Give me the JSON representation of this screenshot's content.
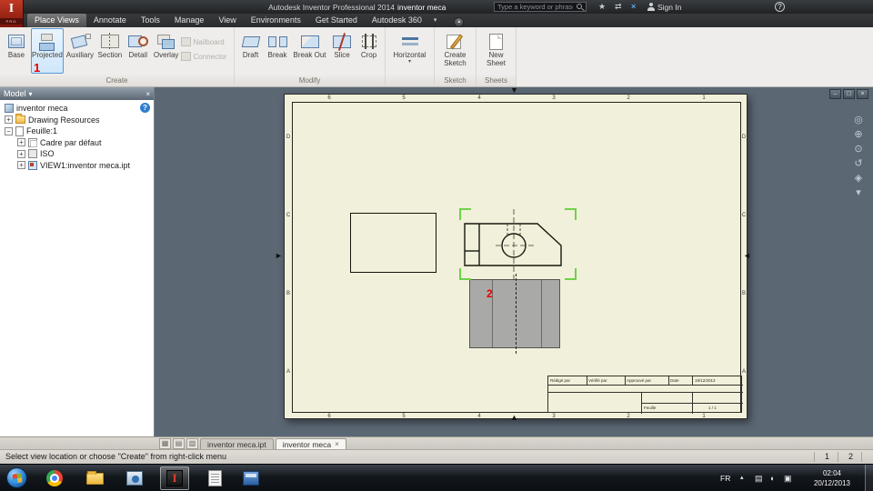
{
  "icons": {
    "close": "×",
    "dropdown": "▾",
    "minimize": "–",
    "restore": "□",
    "up": "▴",
    "plus": "+",
    "minus": "−",
    "help": "?",
    "star": "★",
    "link": "⇄",
    "x_blue": "×",
    "arrow_down": "▼",
    "arrow_up": "▲",
    "arrow_right": "►",
    "arrow_left": "◄",
    "nav": [
      "◎",
      "⊕",
      "⊙",
      "↺",
      "◈",
      "▾"
    ],
    "tray": [
      "▤",
      "◖",
      "▣"
    ],
    "view_buttons": [
      "▦",
      "▤",
      "▧"
    ]
  },
  "title_bar": {
    "logo": "I",
    "logo_sub": "PRO",
    "app_name": "Autodesk Inventor Professional 2014",
    "doc_name": "inventor meca",
    "search_placeholder": "Type a keyword or phrase",
    "sign_in": "Sign In"
  },
  "ribbon_tabs": [
    {
      "label": "Place Views"
    },
    {
      "label": "Annotate"
    },
    {
      "label": "Tools"
    },
    {
      "label": "Manage"
    },
    {
      "label": "View"
    },
    {
      "label": "Environments"
    },
    {
      "label": "Get Started"
    },
    {
      "label": "Autodesk 360"
    }
  ],
  "ribbon": {
    "create_label": "Create",
    "base": "Base",
    "projected": "Projected",
    "auxiliary": "Auxiliary",
    "section": "Section",
    "detail": "Detail",
    "overlay": "Overlay",
    "nailboard": "Nailboard",
    "connector": "Connector",
    "modify_label": "Modify",
    "draft": "Draft",
    "break": "Break",
    "break_out": "Break Out",
    "slice": "Slice",
    "crop": "Crop",
    "horizontal": "Horizontal",
    "sketch_label": "Sketch",
    "create_sketch": "Create Sketch",
    "sheets_label": "Sheets",
    "new_sheet": "New Sheet"
  },
  "annotations": {
    "step1": "1",
    "step2": "2"
  },
  "model_panel": {
    "title": "Model",
    "tree": [
      {
        "label": "inventor meca"
      },
      {
        "label": "Drawing Resources"
      },
      {
        "label": "Feuille:1"
      },
      {
        "label": "Cadre par défaut"
      },
      {
        "label": "ISO"
      },
      {
        "label": "VIEW1:inventor meca.ipt"
      }
    ]
  },
  "sheet": {
    "zones_top": [
      "6",
      "5",
      "4",
      "3",
      "2",
      "1"
    ],
    "zones_bottom": [
      "6",
      "5",
      "4",
      "3",
      "2",
      "1"
    ],
    "zones_right": [
      "D",
      "C",
      "B",
      "A"
    ],
    "zones_left": [
      "D",
      "C",
      "B",
      "A"
    ],
    "title_block": {
      "drawn": "Rédigé par",
      "checked": "Vérifié par",
      "approved": "Approuvé par",
      "date_label": "Date",
      "date": "19/12/2013",
      "sheet_label": "Feuille",
      "sheet_no": "1 / 1"
    }
  },
  "doc_tabs": [
    {
      "label": "inventor meca.ipt"
    },
    {
      "label": "inventor meca"
    }
  ],
  "status_bar": {
    "message": "Select view location or choose \"Create\" from right-click menu",
    "page1": "1",
    "page2": "2"
  },
  "taskbar": {
    "language": "FR",
    "time": "02:04",
    "date": "20/12/2013"
  }
}
